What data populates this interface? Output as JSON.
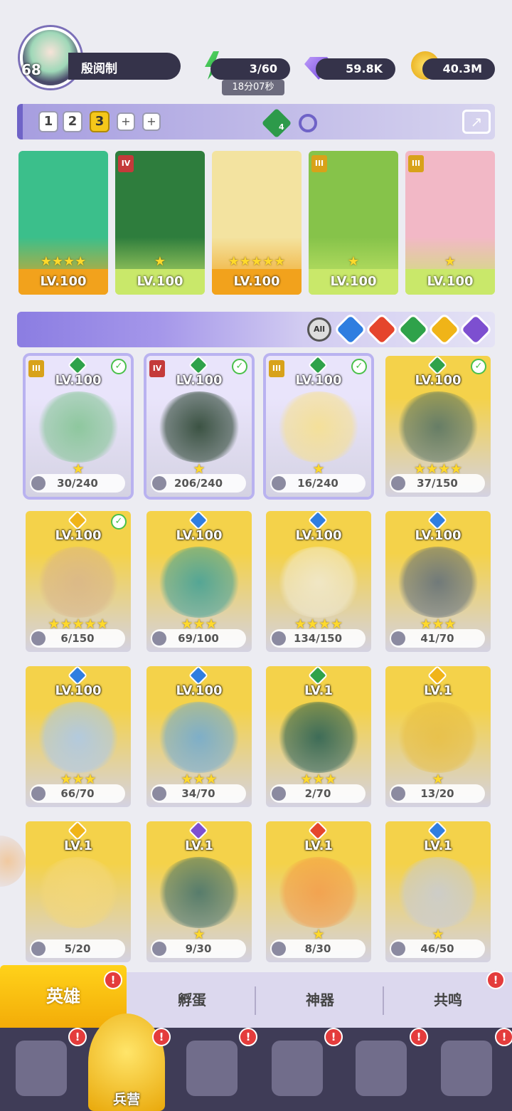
{
  "player": {
    "level": "68",
    "name": "殷阅制"
  },
  "resources": {
    "energy": {
      "value": "3/60",
      "timer": "18分07秒",
      "icon": "lightning-icon"
    },
    "gems": {
      "value": "59.8K",
      "icon": "diamond-icon"
    },
    "coins": {
      "value": "40.3M",
      "icon": "coin-icon"
    }
  },
  "teams": {
    "slots": [
      "1",
      "2",
      "3",
      "+",
      "+"
    ],
    "active": "3",
    "green_element_count": "4"
  },
  "team_heroes": [
    {
      "level": "LV.100",
      "rank": "",
      "stars": "★★★★",
      "bg": "#f2a21c",
      "art": "#3bbf8b"
    },
    {
      "level": "LV.100",
      "rank": "IV",
      "stars": "★",
      "bg": "#c9e86a",
      "art": "#2e7d3d"
    },
    {
      "level": "LV.100",
      "rank": "",
      "stars": "★★★★★",
      "bg": "#f2a21c",
      "art": "#f3e3a0"
    },
    {
      "level": "LV.100",
      "rank": "III",
      "stars": "★",
      "bg": "#c9e86a",
      "art": "#86c34a"
    },
    {
      "level": "LV.100",
      "rank": "III",
      "stars": "★",
      "bg": "#c9e86a",
      "art": "#f2b8c6"
    }
  ],
  "filters": {
    "all_label": "All",
    "elements": [
      "water",
      "fire",
      "nature",
      "light",
      "dark"
    ]
  },
  "heroes": [
    {
      "level": "LV.100",
      "shards": "30/240",
      "stars": "★",
      "element": "nature",
      "rank": "III",
      "checked": true,
      "bg": "#e9e4fb",
      "art": "#7fc38f"
    },
    {
      "level": "LV.100",
      "shards": "206/240",
      "stars": "★",
      "element": "nature",
      "rank": "IV",
      "checked": true,
      "bg": "#e9e4fb",
      "art": "#1e3a24"
    },
    {
      "level": "LV.100",
      "shards": "16/240",
      "stars": "★",
      "element": "nature",
      "rank": "III",
      "checked": true,
      "bg": "#e9e4fb",
      "art": "#f7e08a"
    },
    {
      "level": "LV.100",
      "shards": "37/150",
      "stars": "★★★★",
      "element": "nature",
      "rank": "",
      "checked": true,
      "bg": "#f4d24a",
      "art": "#4f6e63"
    },
    {
      "level": "LV.100",
      "shards": "6/150",
      "stars": "★★★★★",
      "element": "light",
      "rank": "",
      "checked": true,
      "bg": "#f4d24a",
      "art": "#d9b58a"
    },
    {
      "level": "LV.100",
      "shards": "69/100",
      "stars": "★★★",
      "element": "water",
      "rank": "",
      "checked": false,
      "bg": "#f4d24a",
      "art": "#3a9e9a"
    },
    {
      "level": "LV.100",
      "shards": "134/150",
      "stars": "★★★★",
      "element": "water",
      "rank": "",
      "checked": false,
      "bg": "#f4d24a",
      "art": "#f1ead2"
    },
    {
      "level": "LV.100",
      "shards": "41/70",
      "stars": "★★★",
      "element": "water",
      "rank": "",
      "checked": false,
      "bg": "#f4d24a",
      "art": "#5b6a7a"
    },
    {
      "level": "LV.100",
      "shards": "66/70",
      "stars": "★★★",
      "element": "water",
      "rank": "",
      "checked": false,
      "bg": "#f4d24a",
      "art": "#a9c8ef"
    },
    {
      "level": "LV.100",
      "shards": "34/70",
      "stars": "★★★",
      "element": "water",
      "rank": "",
      "checked": false,
      "bg": "#f4d24a",
      "art": "#6ba8d6"
    },
    {
      "level": "LV.1",
      "shards": "2/70",
      "stars": "★★★",
      "element": "nature",
      "rank": "",
      "checked": false,
      "bg": "#f4d24a",
      "art": "#1f5a52"
    },
    {
      "level": "LV.1",
      "shards": "13/20",
      "stars": "★",
      "element": "light",
      "rank": "",
      "checked": false,
      "bg": "#f4d24a",
      "art": "#e7be45"
    },
    {
      "level": "LV.1",
      "shards": "5/20",
      "stars": "",
      "element": "light",
      "rank": "",
      "checked": false,
      "bg": "#f4d24a",
      "art": "#f3d77a"
    },
    {
      "level": "LV.1",
      "shards": "9/30",
      "stars": "★",
      "element": "dark",
      "rank": "",
      "checked": false,
      "bg": "#f4d24a",
      "art": "#3d6d6a"
    },
    {
      "level": "LV.1",
      "shards": "8/30",
      "stars": "★",
      "element": "fire",
      "rank": "",
      "checked": false,
      "bg": "#f4d24a",
      "art": "#f39b4a"
    },
    {
      "level": "LV.1",
      "shards": "46/50",
      "stars": "★",
      "element": "water",
      "rank": "",
      "checked": false,
      "bg": "#f4d24a",
      "art": "#c8ccd6"
    }
  ],
  "tabs": [
    {
      "label": "英雄",
      "active": true,
      "badge": "!"
    },
    {
      "label": "孵蛋",
      "active": false,
      "badge": ""
    },
    {
      "label": "神器",
      "active": false,
      "badge": ""
    },
    {
      "label": "共鸣",
      "active": false,
      "badge": "!"
    }
  ],
  "bottom_nav": [
    {
      "label": "",
      "icon": "cards-icon",
      "badge": "!"
    },
    {
      "label": "兵营",
      "icon": "barracks-icon",
      "badge": "!"
    },
    {
      "label": "",
      "icon": "map-book-icon",
      "badge": "!"
    },
    {
      "label": "",
      "icon": "castle-icon",
      "badge": "!"
    },
    {
      "label": "",
      "icon": "mushroom-hero-icon",
      "badge": "!"
    },
    {
      "label": "",
      "icon": "guild-banner-icon",
      "badge": "!"
    }
  ],
  "element_colors": {
    "water": "#2f7ee0",
    "fire": "#e5452c",
    "nature": "#2fa24a",
    "light": "#f0b418",
    "dark": "#7d4fd0"
  }
}
